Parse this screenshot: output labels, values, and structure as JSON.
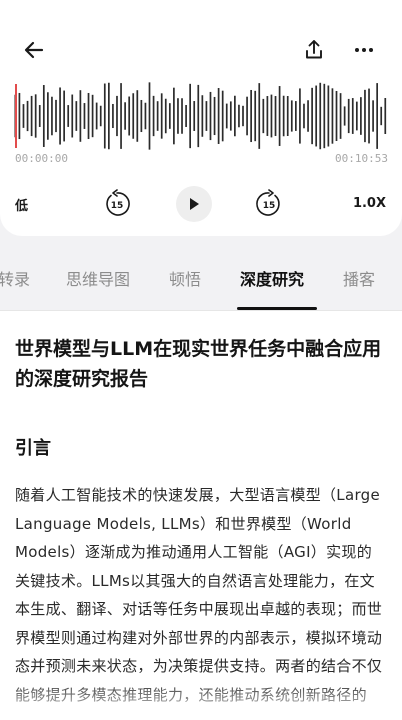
{
  "player": {
    "time_start": "00:00:00",
    "time_end": "00:10:53",
    "progress": 0.0,
    "low_label": "低",
    "rewind_seconds": "15",
    "forward_seconds": "15",
    "rate_label": "1.0X"
  },
  "tabs": [
    {
      "label": "转录",
      "active": false
    },
    {
      "label": "思维导图",
      "active": false
    },
    {
      "label": "顿悟",
      "active": false
    },
    {
      "label": "深度研究",
      "active": true
    },
    {
      "label": "播客",
      "active": false
    }
  ],
  "article": {
    "title": "世界模型与LLM在现实世界任务中融合应用的深度研究报告",
    "section_heading": "引言",
    "paragraph": "随着人工智能技术的快速发展，大型语言模型（Large Language Models, LLMs）和世界模型（World Models）逐渐成为推动通用人工智能（AGI）实现的关键技术。LLMs以其强大的自然语言处理能力，在文本生成、翻译、对话等任务中展现出卓越的表现；而世界模型则通过构建对外部世界的内部表示，模拟环境动态并预测未来状态，为决策提供支持。两者的结合不仅能够提升多模态推理能力，还能推动系统创新路径的"
  },
  "colors": {
    "accent_progress": "#e24c4c",
    "wave_bar": "#2b2b2b",
    "background": "#f2f2f4"
  },
  "icons": [
    "back-arrow-icon",
    "share-icon",
    "more-icon",
    "rewind-15-icon",
    "play-icon",
    "forward-15-icon"
  ]
}
